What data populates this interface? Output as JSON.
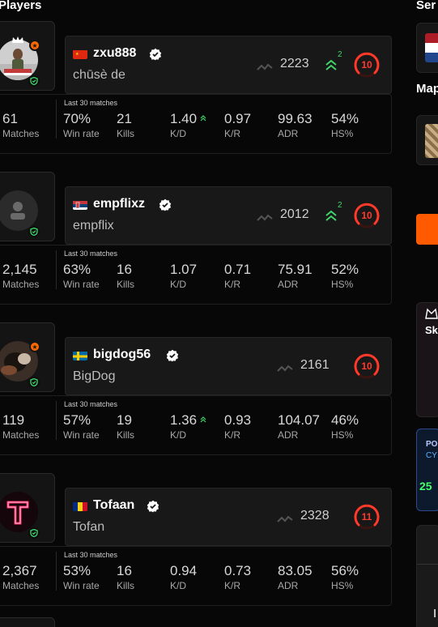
{
  "section_title": "Players",
  "right": {
    "server_title": "Ser",
    "maps_title": "Map",
    "ad1_text": "Sk",
    "ad2_line1": "PO",
    "ad2_line2": "CY",
    "ad2_value": "25",
    "bottom_text": "I"
  },
  "players": [
    {
      "nickname": "zxu888",
      "real_name": "chūsè de",
      "country": "China",
      "elo": "2223",
      "elo_change": "2",
      "level": "10",
      "avatar": "avatar-photo",
      "last_label": "Last 30 matches",
      "stats": [
        {
          "value": "61",
          "label": "Matches"
        },
        {
          "value": "70%",
          "label": "Win rate"
        },
        {
          "value": "21",
          "label": "Kills"
        },
        {
          "value": "1.40",
          "label": "K/D"
        },
        {
          "value": "0.97",
          "label": "K/R"
        },
        {
          "value": "99.63",
          "label": "ADR"
        },
        {
          "value": "54%",
          "label": "HS%"
        }
      ]
    },
    {
      "nickname": "empflixz",
      "real_name": "empflix",
      "country": "Serbia",
      "elo": "2012",
      "elo_change": "2",
      "level": "10",
      "avatar": "default-avatar",
      "last_label": "Last 30 matches",
      "stats": [
        {
          "value": "2,145",
          "label": "Matches"
        },
        {
          "value": "63%",
          "label": "Win rate"
        },
        {
          "value": "16",
          "label": "Kills"
        },
        {
          "value": "1.07",
          "label": "K/D"
        },
        {
          "value": "0.71",
          "label": "K/R"
        },
        {
          "value": "75.91",
          "label": "ADR"
        },
        {
          "value": "52%",
          "label": "HS%"
        }
      ]
    },
    {
      "nickname": "bigdog56",
      "real_name": "BigDog",
      "country": "Sweden",
      "elo": "2161",
      "level": "10",
      "avatar": "avatar-photo",
      "last_label": "Last 30 matches",
      "stats": [
        {
          "value": "119",
          "label": "Matches"
        },
        {
          "value": "57%",
          "label": "Win rate"
        },
        {
          "value": "19",
          "label": "Kills"
        },
        {
          "value": "1.36",
          "label": "K/D"
        },
        {
          "value": "0.93",
          "label": "K/R"
        },
        {
          "value": "104.07",
          "label": "ADR"
        },
        {
          "value": "46%",
          "label": "HS%"
        }
      ]
    },
    {
      "nickname": "Tofaan",
      "real_name": "Tofan",
      "country": "Romania",
      "elo": "2328",
      "level": "11",
      "avatar": "neon-t-avatar",
      "last_label": "Last 30 matches",
      "stats": [
        {
          "value": "2,367",
          "label": "Matches"
        },
        {
          "value": "53%",
          "label": "Win rate"
        },
        {
          "value": "16",
          "label": "Kills"
        },
        {
          "value": "0.94",
          "label": "K/D"
        },
        {
          "value": "0.73",
          "label": "K/R"
        },
        {
          "value": "83.05",
          "label": "ADR"
        },
        {
          "value": "56%",
          "label": "HS%"
        }
      ]
    }
  ],
  "colors": {
    "accent_orange": "#ff6a00",
    "level_red": "#ff3a2b",
    "up_green": "#42d46b",
    "shield_green": "#3ddc6a"
  }
}
